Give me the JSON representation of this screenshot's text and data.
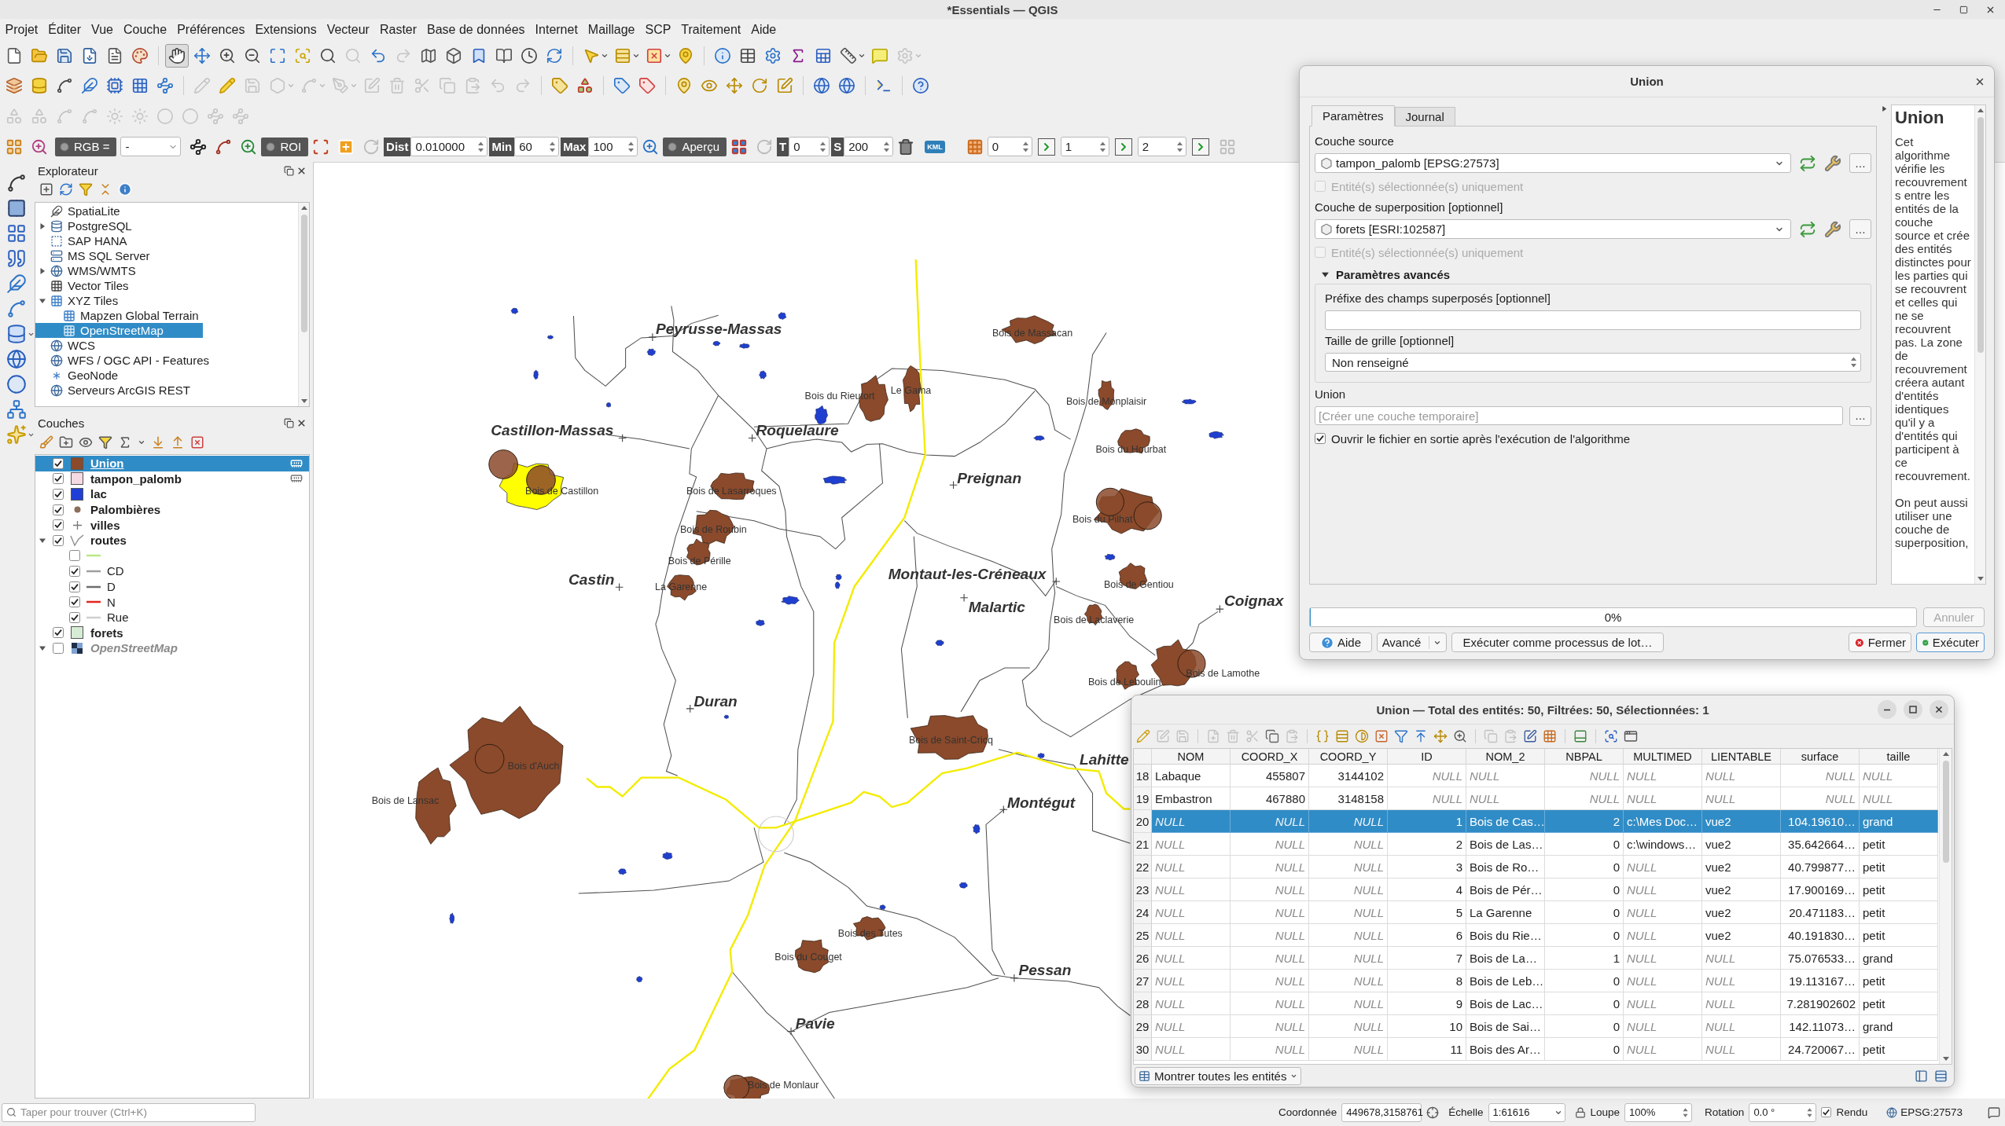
{
  "window": {
    "title": "*Essentials — QGIS"
  },
  "menu": [
    "Projet",
    "Éditer",
    "Vue",
    "Couche",
    "Préférences",
    "Extensions",
    "Vecteur",
    "Raster",
    "Base de données",
    "Internet",
    "Maillage",
    "SCP",
    "Traitement",
    "Aide"
  ],
  "toolbar_rows": [
    [
      {
        "disabled": false,
        "selected": false
      },
      {
        "disabled": false,
        "selected": false
      },
      {
        "disabled": false,
        "selected": false
      },
      {
        "disabled": false,
        "selected": false
      },
      {
        "disabled": false,
        "selected": false
      },
      {
        "disabled": false,
        "selected": false
      },
      {
        "disabled": false,
        "selected": true
      },
      {
        "disabled": false,
        "selected": false
      },
      {
        "disabled": false,
        "selected": false
      },
      {
        "disabled": false,
        "selected": false
      },
      {
        "disabled": false,
        "selected": false
      },
      {
        "disabled": false,
        "selected": false
      },
      {
        "disabled": false,
        "selected": false
      },
      {
        "disabled": true,
        "selected": false
      },
      {
        "disabled": false,
        "selected": false
      },
      {
        "disabled": true,
        "selected": false
      },
      {
        "disabled": false,
        "selected": false
      },
      {
        "disabled": false,
        "selected": false
      },
      {
        "disabled": false,
        "selected": false
      },
      {
        "disabled": false,
        "selected": false
      },
      {
        "disabled": false,
        "selected": false
      },
      {
        "disabled": false,
        "selected": false
      },
      {
        "disabled": false,
        "selected": false
      },
      {
        "disabled": false,
        "selected": false
      },
      {
        "disabled": false,
        "selected": false
      },
      {
        "disabled": false,
        "selected": false
      },
      {
        "disabled": false,
        "selected": false
      },
      {
        "disabled": false,
        "selected": false
      },
      {
        "disabled": false,
        "selected": false
      },
      {
        "disabled": false,
        "selected": false
      },
      {
        "disabled": false,
        "selected": false
      },
      {
        "disabled": false,
        "selected": false
      },
      {
        "disabled": false,
        "selected": false
      },
      {
        "disabled": true,
        "selected": false
      }
    ],
    [
      {
        "disabled": false
      },
      {
        "disabled": false
      },
      {
        "disabled": false
      },
      {
        "disabled": false
      },
      {
        "disabled": false
      },
      {
        "disabled": false
      },
      {
        "disabled": false
      },
      {
        "disabled": true
      },
      {
        "disabled": false
      },
      {
        "disabled": true
      },
      {
        "disabled": true
      },
      {
        "disabled": true
      },
      {
        "disabled": true
      },
      {
        "disabled": true
      },
      {
        "disabled": true
      },
      {
        "disabled": true
      },
      {
        "disabled": true
      },
      {
        "disabled": true
      },
      {
        "disabled": true
      },
      {
        "disabled": true
      },
      {
        "disabled": false
      },
      {
        "disabled": false
      },
      {
        "disabled": false
      },
      {
        "disabled": false
      },
      {
        "disabled": false
      },
      {
        "disabled": false
      },
      {
        "disabled": false
      },
      {
        "disabled": false
      },
      {
        "disabled": false
      },
      {
        "disabled": false
      },
      {
        "disabled": false
      },
      {
        "disabled": false
      },
      {
        "disabled": false
      }
    ],
    [
      {
        "disabled": true
      },
      {
        "disabled": true
      },
      {
        "disabled": true
      },
      {
        "disabled": true
      },
      {
        "disabled": true
      },
      {
        "disabled": true
      },
      {
        "disabled": true
      },
      {
        "disabled": true
      },
      {
        "disabled": true
      },
      {
        "disabled": true
      }
    ]
  ],
  "scp_toolbar": {
    "rgb_label": "RGB =",
    "band_combo": "-",
    "roi_label": "ROI",
    "dist": {
      "label": "Dist",
      "value": "0.010000"
    },
    "min": {
      "label": "Min",
      "value": "60"
    },
    "max": {
      "label": "Max",
      "value": "100"
    },
    "preview_label": "Aperçu",
    "t": {
      "label": "T",
      "value": "0"
    },
    "s": {
      "label": "S",
      "value": "200"
    },
    "kml_label": "KML",
    "bands": [
      "0",
      "1",
      "2"
    ]
  },
  "browser": {
    "title": "Explorateur",
    "items": [
      {
        "label": "SpatiaLite",
        "selected": false
      },
      {
        "label": "PostgreSQL",
        "selected": false,
        "expanded": false
      },
      {
        "label": "SAP HANA",
        "selected": false
      },
      {
        "label": "MS SQL Server",
        "selected": false
      },
      {
        "label": "WMS/WMTS",
        "selected": false,
        "expanded": false
      },
      {
        "label": "Vector Tiles",
        "selected": false
      },
      {
        "label": "XYZ Tiles",
        "selected": false,
        "expanded": true,
        "children": [
          {
            "label": "Mapzen Global Terrain",
            "selected": false
          },
          {
            "label": "OpenStreetMap",
            "selected": true
          }
        ]
      },
      {
        "label": "WCS",
        "selected": false
      },
      {
        "label": "WFS / OGC API - Features",
        "selected": false
      },
      {
        "label": "GeoNode",
        "selected": false
      },
      {
        "label": "Serveurs ArcGIS REST",
        "selected": false
      }
    ]
  },
  "layers_panel": {
    "title": "Couches",
    "layers": [
      {
        "name": "Union",
        "kind": "polygon",
        "color": "#8b4a2b",
        "checked": true,
        "selected": true,
        "temporary": true
      },
      {
        "name": "tampon_palomb",
        "kind": "polygon",
        "color": "#f7d9e4",
        "checked": true,
        "selected": false,
        "temporary": true
      },
      {
        "name": "lac",
        "kind": "polygon",
        "color": "#1f3fd6",
        "checked": true,
        "selected": false,
        "temporary": false
      },
      {
        "name": "Palombières",
        "kind": "point",
        "color": "#8b6e5c",
        "checked": true,
        "selected": false,
        "temporary": false
      },
      {
        "name": "villes",
        "kind": "cross",
        "checked": true,
        "selected": false,
        "temporary": false
      },
      {
        "name": "routes",
        "kind": "line",
        "checked": true,
        "selected": false,
        "temporary": false,
        "expanded": true,
        "children": [
          {
            "checked": false,
            "color": "#b8e986"
          },
          {
            "name": "CD",
            "checked": true,
            "color": "#9e9e9e"
          },
          {
            "name": "D",
            "checked": true,
            "color": "#6e6e6e"
          },
          {
            "name": "N",
            "checked": true,
            "color": "#e3261c"
          },
          {
            "name": "Rue",
            "checked": true,
            "color": "#cfcfcf"
          }
        ]
      },
      {
        "name": "forets",
        "kind": "polygon",
        "color": "#d7ecd5",
        "checked": true,
        "selected": false,
        "temporary": false
      },
      {
        "name": "OpenStreetMap",
        "kind": "raster",
        "checked": false,
        "selected": false,
        "temporary": false,
        "expanded": true
      }
    ]
  },
  "map": {
    "towns": [
      "Peyrusse-Massas",
      "Castillon-Massas",
      "Roquelaure",
      "Preignan",
      "Castin",
      "Montaut-les-Créneaux",
      "Malartic",
      "Coignax",
      "Duran",
      "Lahitte",
      "Montégut",
      "Pessan",
      "Pavie"
    ],
    "forest_labels": [
      "Bois de Massacan",
      "Bois du Rieutort",
      "Le Gama",
      "Bois de Monplaisir",
      "Bois du Hourbat",
      "Bois de Castillon",
      "Bois de Lasarroques",
      "Bois de Roubin",
      "Bois de Pérille",
      "La Garenne",
      "Bois du Pilhat",
      "Bois de Gentiou",
      "Bois de Laclaverie",
      "Bois de Lamothe",
      "Bois de Leboulin",
      "Bois de Saint-Cricq",
      "Bois d'Auch",
      "Bois de Lansac",
      "Bois des Tutes",
      "Bois du Couget",
      "Bois de Monlaur"
    ]
  },
  "dialog": {
    "title": "Union",
    "tabs": [
      {
        "label": "Paramètres",
        "selected": true
      },
      {
        "label": "Journal",
        "selected": false
      }
    ],
    "source": {
      "label": "Couche source",
      "value": "tampon_palomb [EPSG:27573]",
      "browse": "…",
      "selected_only": {
        "label": "Entité(s) sélectionnée(s) uniquement",
        "checked": false,
        "disabled": true
      }
    },
    "overlay": {
      "label": "Couche de superposition [optionnel]",
      "value": "forets [ESRI:102587]",
      "browse": "…",
      "selected_only": {
        "label": "Entité(s) sélectionnée(s) uniquement",
        "checked": false,
        "disabled": true
      }
    },
    "advanced": {
      "label": "Paramètres avancés",
      "expanded": true,
      "prefix_label": "Préfixe des champs superposés [optionnel]",
      "grid_label": "Taille de grille [optionnel]",
      "grid_value": "Non renseigné"
    },
    "output": {
      "label": "Union",
      "placeholder": "[Créer une couche temporaire]",
      "browse": "…"
    },
    "open_output": {
      "label": "Ouvrir le fichier en sortie après l'exécution de l'algorithme",
      "checked": true
    },
    "help": {
      "title": "Union",
      "paragraphs": [
        "Cet algorithme vérifie les recouvrements entre les entités de la couche source et crée des entités distinctes pour les parties qui se recouvrent et celles qui ne se recouvrent pas. La zone de recouvrement créera autant d'entités identiques qu'il y a d'entités qui participent à ce recouvrement.",
        "On peut aussi utiliser une couche de superposition,"
      ]
    },
    "progress": {
      "level": 0,
      "text": "0%"
    },
    "cancel": {
      "label": "Annuler",
      "disabled": true
    },
    "buttons": {
      "help": "Aide",
      "advanced": "Avancé",
      "batch": "Exécuter comme processus de lot…",
      "close": "Fermer",
      "run": "Exécuter"
    }
  },
  "attribute_table": {
    "title": "Union — Total des entités: 50, Filtrées: 50, Sélectionnées: 1",
    "toolbar": [
      {
        "disabled": false
      },
      {
        "disabled": true
      },
      {
        "disabled": true
      },
      {
        "disabled": true
      },
      {
        "disabled": true
      },
      {
        "disabled": true
      },
      {
        "disabled": false
      },
      {
        "disabled": true
      },
      {
        "disabled": false
      },
      {
        "disabled": false
      },
      {
        "disabled": false
      },
      {
        "disabled": false
      },
      {
        "disabled": false
      },
      {
        "disabled": false
      },
      {
        "disabled": false
      },
      {
        "disabled": false
      },
      {
        "disabled": true
      },
      {
        "disabled": true
      },
      {
        "disabled": false
      },
      {
        "disabled": false
      },
      {
        "disabled": false
      },
      {
        "disabled": false
      },
      {
        "disabled": false
      }
    ],
    "columns": [
      "NOM",
      "COORD_X",
      "COORD_Y",
      "ID",
      "NOM_2",
      "NBPAL",
      "MULTIMED",
      "LIENTABLE",
      "surface",
      "taille"
    ],
    "rows": [
      {
        "number": "18",
        "selected": false,
        "cells": [
          "Labaque",
          "455807",
          "3144102",
          {
            "text": "NULL",
            "kind": "null"
          },
          {
            "text": "NULL",
            "kind": "null"
          },
          {
            "text": "NULL",
            "kind": "null"
          },
          {
            "text": "NULL",
            "kind": "null"
          },
          {
            "text": "NULL",
            "kind": "null"
          },
          {
            "text": "NULL",
            "kind": "null"
          },
          {
            "text": "NULL",
            "kind": "null"
          }
        ]
      },
      {
        "number": "19",
        "selected": false,
        "cells": [
          "Embastron",
          "467880",
          "3148158",
          {
            "text": "NULL",
            "kind": "null"
          },
          {
            "text": "NULL",
            "kind": "null"
          },
          {
            "text": "NULL",
            "kind": "null"
          },
          {
            "text": "NULL",
            "kind": "null"
          },
          {
            "text": "NULL",
            "kind": "null"
          },
          {
            "text": "NULL",
            "kind": "null"
          },
          {
            "text": "NULL",
            "kind": "null"
          }
        ]
      },
      {
        "number": "20",
        "selected": true,
        "cells": [
          {
            "text": "NULL",
            "kind": "null"
          },
          {
            "text": "NULL",
            "kind": "null"
          },
          {
            "text": "NULL",
            "kind": "null"
          },
          "1",
          "Bois de Cas…",
          "2",
          "c:\\Mes Doc…",
          "vue2",
          "104.19610…",
          "grand"
        ]
      },
      {
        "number": "21",
        "selected": false,
        "cells": [
          {
            "text": "NULL",
            "kind": "null"
          },
          {
            "text": "NULL",
            "kind": "null"
          },
          {
            "text": "NULL",
            "kind": "null"
          },
          "2",
          "Bois de Las…",
          "0",
          "c:\\windows…",
          "vue2",
          "35.642664…",
          "petit"
        ]
      },
      {
        "number": "22",
        "selected": false,
        "cells": [
          {
            "text": "NULL",
            "kind": "null"
          },
          {
            "text": "NULL",
            "kind": "null"
          },
          {
            "text": "NULL",
            "kind": "null"
          },
          "3",
          "Bois de Ro…",
          "0",
          {
            "text": "NULL",
            "kind": "null"
          },
          "vue2",
          "40.799877…",
          "petit"
        ]
      },
      {
        "number": "23",
        "selected": false,
        "cells": [
          {
            "text": "NULL",
            "kind": "null"
          },
          {
            "text": "NULL",
            "kind": "null"
          },
          {
            "text": "NULL",
            "kind": "null"
          },
          "4",
          "Bois de Pér…",
          "0",
          {
            "text": "NULL",
            "kind": "null"
          },
          "vue2",
          "17.900169…",
          "petit"
        ]
      },
      {
        "number": "24",
        "selected": false,
        "cells": [
          {
            "text": "NULL",
            "kind": "null"
          },
          {
            "text": "NULL",
            "kind": "null"
          },
          {
            "text": "NULL",
            "kind": "null"
          },
          "5",
          "La Garenne",
          "0",
          {
            "text": "NULL",
            "kind": "null"
          },
          "vue2",
          "20.471183…",
          "petit"
        ]
      },
      {
        "number": "25",
        "selected": false,
        "cells": [
          {
            "text": "NULL",
            "kind": "null"
          },
          {
            "text": "NULL",
            "kind": "null"
          },
          {
            "text": "NULL",
            "kind": "null"
          },
          "6",
          "Bois du Rie…",
          "0",
          {
            "text": "NULL",
            "kind": "null"
          },
          "vue2",
          "40.191830…",
          "petit"
        ]
      },
      {
        "number": "26",
        "selected": false,
        "cells": [
          {
            "text": "NULL",
            "kind": "null"
          },
          {
            "text": "NULL",
            "kind": "null"
          },
          {
            "text": "NULL",
            "kind": "null"
          },
          "7",
          "Bois de La…",
          "1",
          {
            "text": "NULL",
            "kind": "null"
          },
          {
            "text": "NULL",
            "kind": "null"
          },
          "75.076533…",
          "grand"
        ]
      },
      {
        "number": "27",
        "selected": false,
        "cells": [
          {
            "text": "NULL",
            "kind": "null"
          },
          {
            "text": "NULL",
            "kind": "null"
          },
          {
            "text": "NULL",
            "kind": "null"
          },
          "8",
          "Bois de Leb…",
          "0",
          {
            "text": "NULL",
            "kind": "null"
          },
          {
            "text": "NULL",
            "kind": "null"
          },
          "19.113167…",
          "petit"
        ]
      },
      {
        "number": "28",
        "selected": false,
        "cells": [
          {
            "text": "NULL",
            "kind": "null"
          },
          {
            "text": "NULL",
            "kind": "null"
          },
          {
            "text": "NULL",
            "kind": "null"
          },
          "9",
          "Bois de Lac…",
          "0",
          {
            "text": "NULL",
            "kind": "null"
          },
          {
            "text": "NULL",
            "kind": "null"
          },
          "7.281902602",
          "petit"
        ]
      },
      {
        "number": "29",
        "selected": false,
        "cells": [
          {
            "text": "NULL",
            "kind": "null"
          },
          {
            "text": "NULL",
            "kind": "null"
          },
          {
            "text": "NULL",
            "kind": "null"
          },
          "10",
          "Bois de Sai…",
          "0",
          {
            "text": "NULL",
            "kind": "null"
          },
          {
            "text": "NULL",
            "kind": "null"
          },
          "142.11073…",
          "grand"
        ]
      },
      {
        "number": "30",
        "selected": false,
        "cells": [
          {
            "text": "NULL",
            "kind": "null"
          },
          {
            "text": "NULL",
            "kind": "null"
          },
          {
            "text": "NULL",
            "kind": "null"
          },
          "11",
          "Bois des Ar…",
          "0",
          {
            "text": "NULL",
            "kind": "null"
          },
          {
            "text": "NULL",
            "kind": "null"
          },
          "24.720067…",
          "petit"
        ]
      }
    ],
    "footer_button": "Montrer toutes les entités"
  },
  "status_bar": {
    "locator_placeholder": "Taper pour trouver (Ctrl+K)",
    "coordinate_label": "Coordonnée",
    "coordinate": "449678,3158761",
    "scale_label": "Échelle",
    "scale": "1:61616",
    "magnifier_label": "Loupe",
    "magnifier": "100%",
    "rotation_label": "Rotation",
    "rotation": "0.0 °",
    "render": {
      "label": "Rendu",
      "checked": true
    },
    "crs": "EPSG:27573"
  }
}
